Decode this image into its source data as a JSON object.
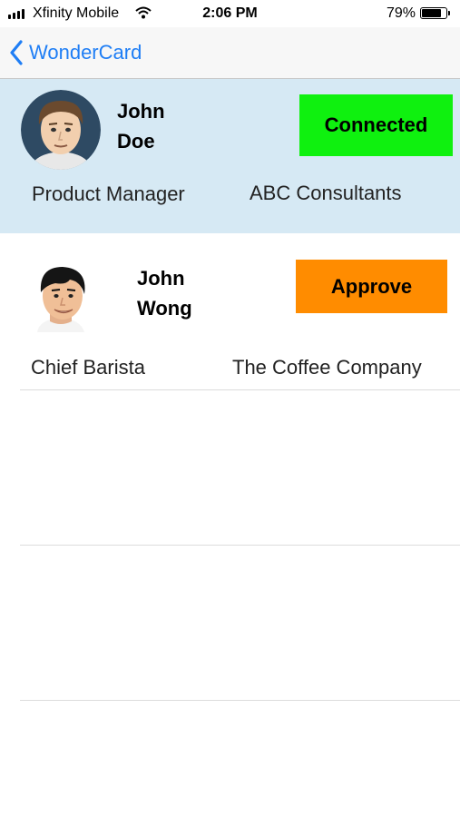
{
  "status_bar": {
    "carrier": "Xfinity Mobile",
    "time": "2:06 PM",
    "battery_percent": "79%",
    "battery_level": 0.79
  },
  "nav": {
    "back_label": "WonderCard",
    "accent_color": "#1f7ef5"
  },
  "contacts": [
    {
      "first_name": "John",
      "last_name": "Doe",
      "title": "Product Manager",
      "company": "ABC Consultants",
      "action_label": "Connected",
      "action_color": "#0ff10f",
      "avatar": "man-avatar-icon"
    },
    {
      "first_name": "John",
      "last_name": "Wong",
      "title": "Chief Barista",
      "company": "The Coffee Company",
      "action_label": "Approve",
      "action_color": "#ff8c00",
      "avatar": "man-avatar-icon"
    }
  ]
}
